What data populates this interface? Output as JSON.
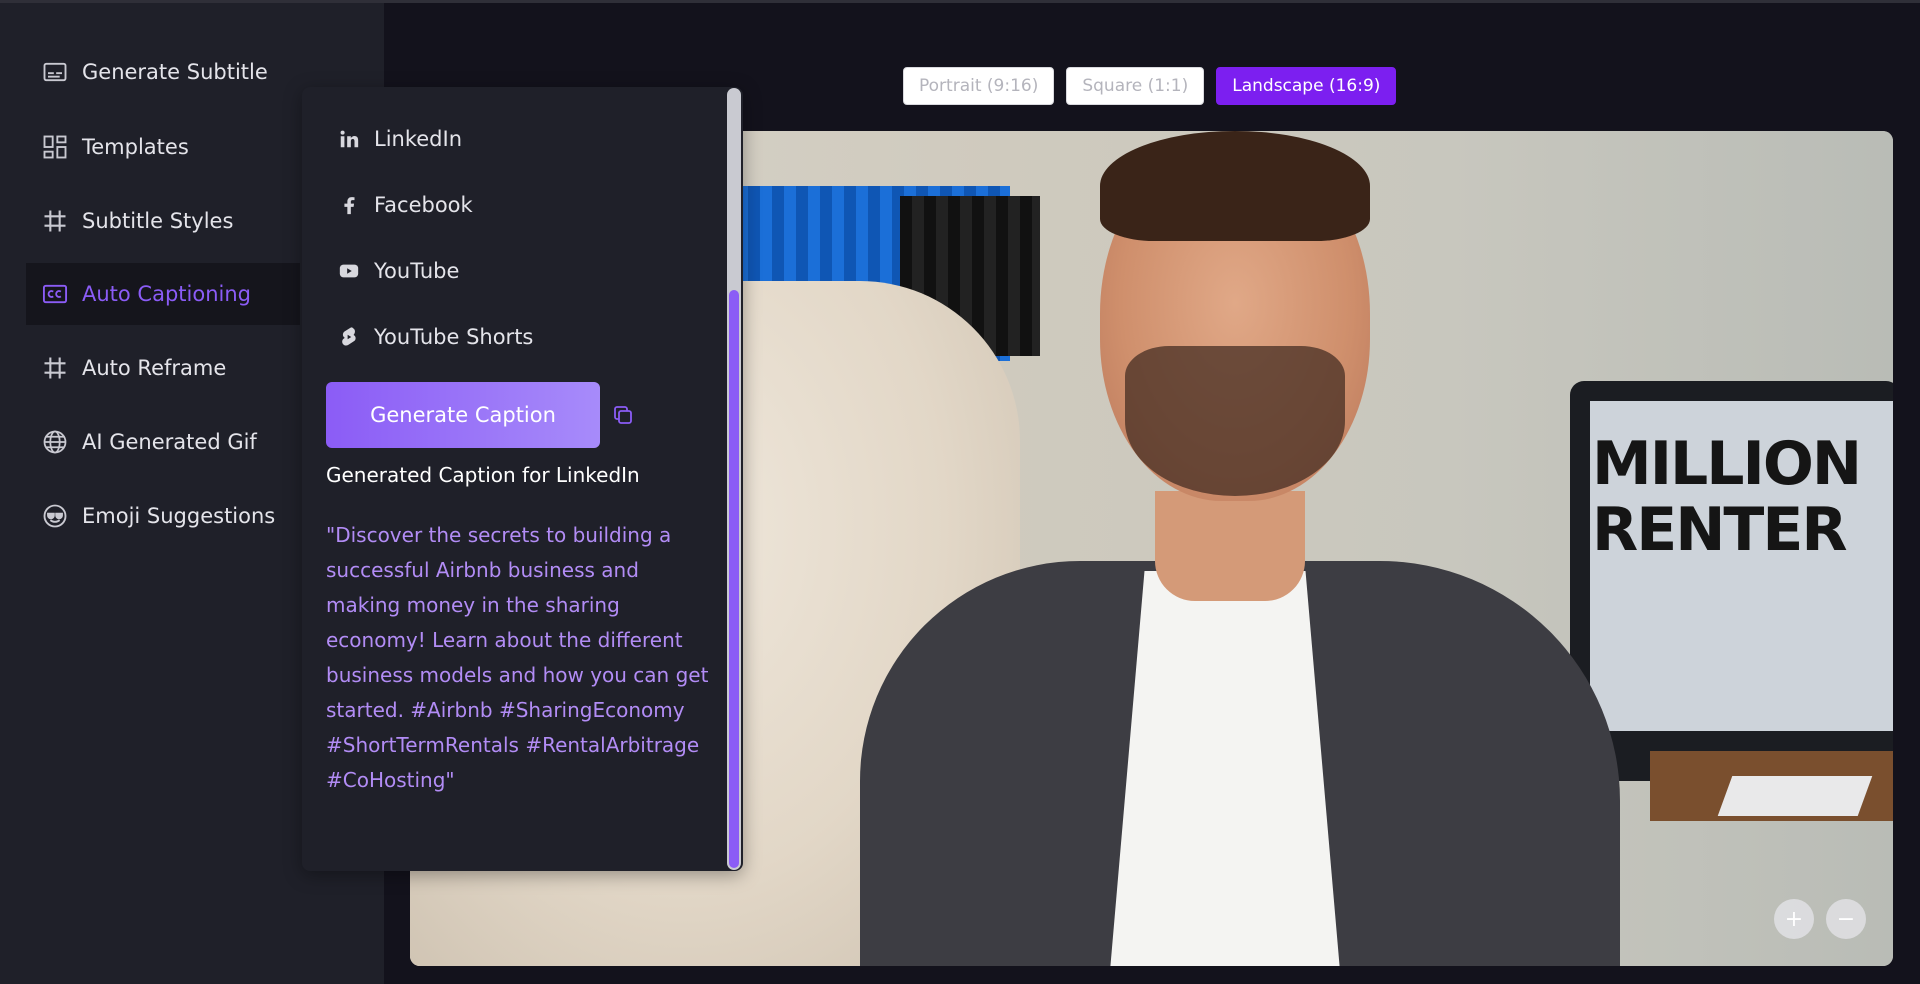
{
  "sidebar": {
    "items": [
      {
        "label": "Generate Subtitle",
        "icon": "subtitle-icon"
      },
      {
        "label": "Templates",
        "icon": "templates-icon"
      },
      {
        "label": "Subtitle Styles",
        "icon": "hash-icon"
      },
      {
        "label": "Auto Captioning",
        "icon": "cc-icon",
        "active": true
      },
      {
        "label": "Auto Reframe",
        "icon": "hash-icon"
      },
      {
        "label": "AI Generated Gif",
        "icon": "globe-icon"
      },
      {
        "label": "Emoji Suggestions",
        "icon": "emoji-icon"
      }
    ]
  },
  "ratio": {
    "options": [
      "Portrait (9:16)",
      "Square (1:1)",
      "Landscape (16:9)"
    ],
    "selected": "Landscape (16:9)"
  },
  "video": {
    "overlay_text": "MILLION\nRENTER",
    "zoom_in": "+",
    "zoom_out": "−"
  },
  "caption_panel": {
    "platforms": [
      {
        "label": "LinkedIn",
        "icon": "linkedin-icon"
      },
      {
        "label": "Facebook",
        "icon": "facebook-icon"
      },
      {
        "label": "YouTube",
        "icon": "youtube-icon"
      },
      {
        "label": "YouTube Shorts",
        "icon": "youtube-shorts-icon"
      }
    ],
    "generate_button": "Generate Caption",
    "result_title": "Generated Caption for LinkedIn",
    "result_text": "\"Discover the secrets to building a successful Airbnb business and making money in the sharing economy! Learn about the different business models and how you can get started. #Airbnb #SharingEconomy #ShortTermRentals #RentalArbitrage #CoHosting\""
  },
  "colors": {
    "accent": "#8b5cf6",
    "sidebar_bg": "#1f2029",
    "canvas_bg": "#13121c",
    "caption_text": "#b28cf5",
    "ratio_active": "#7c1ff0"
  }
}
